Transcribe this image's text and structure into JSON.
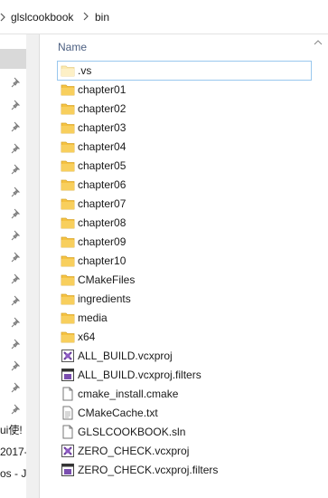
{
  "address": {
    "crumbs": [
      "glslcookbook",
      "bin"
    ]
  },
  "columns": {
    "name_label": "Name"
  },
  "nav": {
    "cut_labels": [
      "ui使!",
      "2017-",
      "os - JU"
    ]
  },
  "files": [
    {
      "name": ".vs",
      "icon": "folder-light-icon"
    },
    {
      "name": "chapter01",
      "icon": "folder-icon"
    },
    {
      "name": "chapter02",
      "icon": "folder-icon"
    },
    {
      "name": "chapter03",
      "icon": "folder-icon"
    },
    {
      "name": "chapter04",
      "icon": "folder-icon"
    },
    {
      "name": "chapter05",
      "icon": "folder-icon"
    },
    {
      "name": "chapter06",
      "icon": "folder-icon"
    },
    {
      "name": "chapter07",
      "icon": "folder-icon"
    },
    {
      "name": "chapter08",
      "icon": "folder-icon"
    },
    {
      "name": "chapter09",
      "icon": "folder-icon"
    },
    {
      "name": "chapter10",
      "icon": "folder-icon"
    },
    {
      "name": "CMakeFiles",
      "icon": "folder-icon"
    },
    {
      "name": "ingredients",
      "icon": "folder-icon"
    },
    {
      "name": "media",
      "icon": "folder-icon"
    },
    {
      "name": "x64",
      "icon": "folder-icon"
    },
    {
      "name": "ALL_BUILD.vcxproj",
      "icon": "vcxproj-icon"
    },
    {
      "name": "ALL_BUILD.vcxproj.filters",
      "icon": "filters-icon"
    },
    {
      "name": "cmake_install.cmake",
      "icon": "document-icon"
    },
    {
      "name": "CMakeCache.txt",
      "icon": "text-file-icon"
    },
    {
      "name": "GLSLCOOKBOOK.sln",
      "icon": "solution-icon"
    },
    {
      "name": "ZERO_CHECK.vcxproj",
      "icon": "vcxproj-icon"
    },
    {
      "name": "ZERO_CHECK.vcxproj.filters",
      "icon": "filters-icon"
    }
  ],
  "colors": {
    "folder": "#f5c242",
    "folder_light": "#fbe9b0",
    "header_text": "#4d6082",
    "focus_border": "#99c7ee"
  }
}
